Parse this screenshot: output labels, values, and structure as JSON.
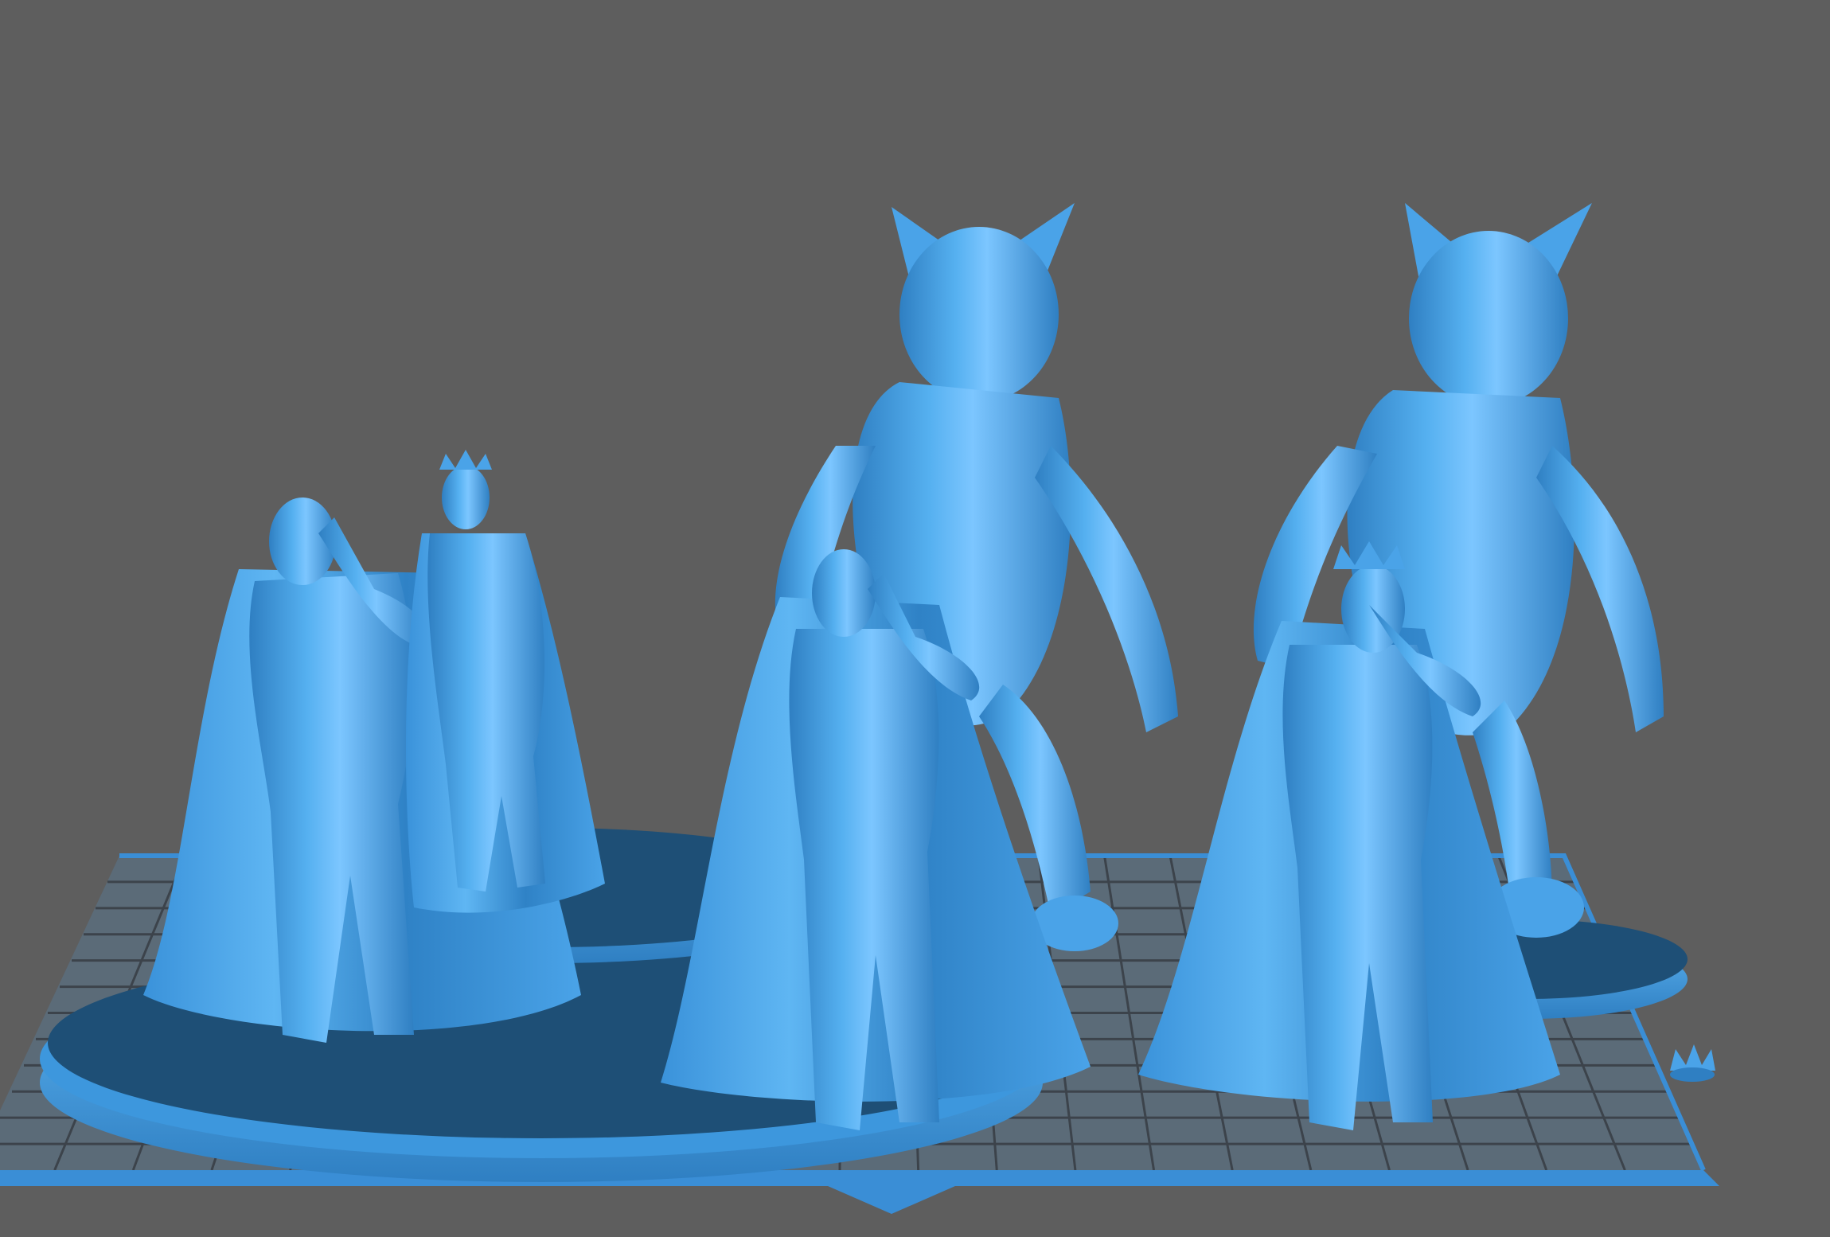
{
  "viewport": {
    "background": "#5e5e5e"
  },
  "bed": {
    "fill": "#5b6b78",
    "grid_line": "#3c434b",
    "edge": "#3a8ed6",
    "edge_dark": "#2b6fa8"
  },
  "model": {
    "color": "#4aa3e8",
    "shadow": "#2f7fc2",
    "highlight": "#8fd0ff",
    "base_top": "#1e4f76",
    "base_side": "#3d97dd"
  },
  "objects": [
    {
      "name": "saluting-king-figure"
    },
    {
      "name": "crowned-king-figure"
    },
    {
      "name": "sphynx-cat-with-king"
    },
    {
      "name": "sphynx-cat-with-crowned-king"
    },
    {
      "name": "crown"
    }
  ]
}
